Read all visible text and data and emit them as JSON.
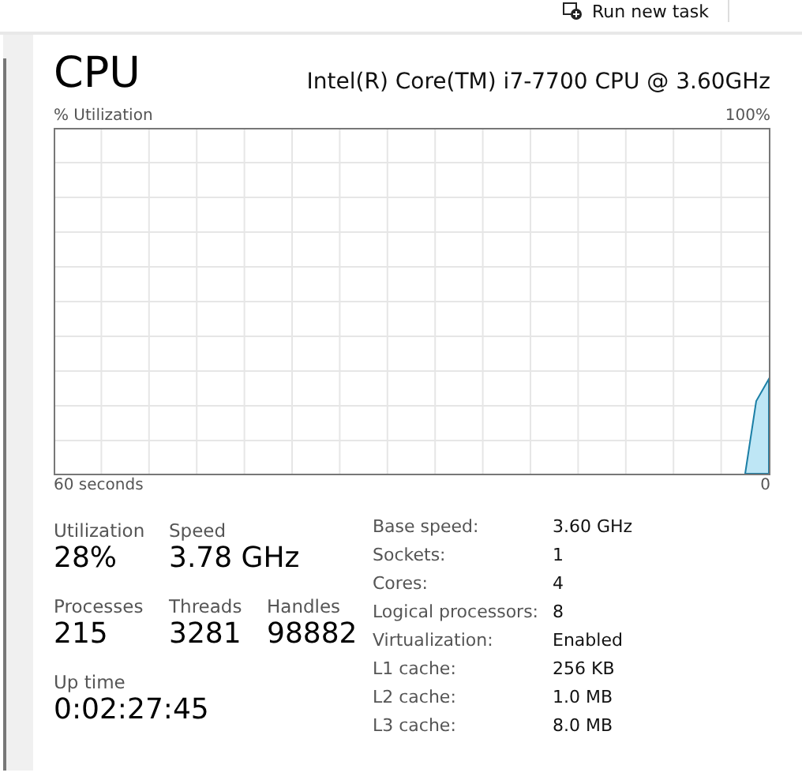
{
  "toolbar": {
    "run_task": "Run new task"
  },
  "header": {
    "title": "CPU",
    "processor": "Intel(R) Core(TM) i7-7700 CPU @ 3.60GHz"
  },
  "graph": {
    "y_label": "% Utilization",
    "y_max": "100%",
    "x_label": "60 seconds",
    "x_min": "0"
  },
  "stats": [
    {
      "label": "Utilization",
      "value": "28%"
    },
    {
      "label": "Speed",
      "value": "3.78 GHz"
    },
    {
      "label": "Processes",
      "value": "215"
    },
    {
      "label": "Threads",
      "value": "3281"
    },
    {
      "label": "Handles",
      "value": "98882"
    },
    {
      "label": "Up time",
      "value": "0:02:27:45"
    }
  ],
  "details": [
    {
      "label": "Base speed:",
      "value": "3.60 GHz"
    },
    {
      "label": "Sockets:",
      "value": "1"
    },
    {
      "label": "Cores:",
      "value": "4"
    },
    {
      "label": "Logical processors:",
      "value": "8"
    },
    {
      "label": "Virtualization:",
      "value": "Enabled"
    },
    {
      "label": "L1 cache:",
      "value": "256 KB"
    },
    {
      "label": "L2 cache:",
      "value": "1.0 MB"
    },
    {
      "label": "L3 cache:",
      "value": "8.0 MB"
    }
  ]
}
